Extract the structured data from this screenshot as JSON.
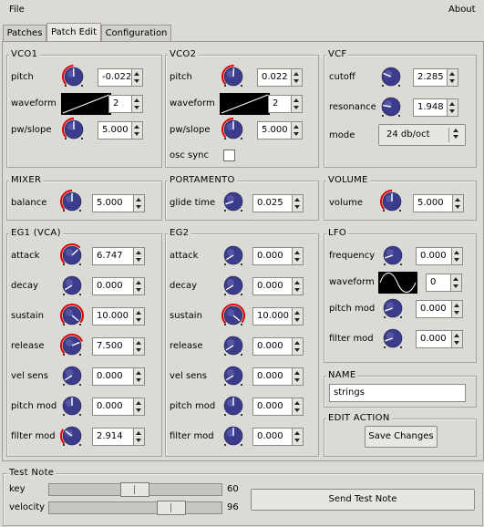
{
  "menubar": {
    "file": "File",
    "about": "About"
  },
  "tabs": [
    "Patches",
    "Patch Edit",
    "Configuration"
  ],
  "vco1": {
    "title": "VCO1",
    "pitch_label": "pitch",
    "pitch_value": "-0.022",
    "waveform_label": "waveform",
    "waveform_value": "2",
    "pw_label": "pw/slope",
    "pw_value": "5.000"
  },
  "vco2": {
    "title": "VCO2",
    "pitch_label": "pitch",
    "pitch_value": "0.022",
    "waveform_label": "waveform",
    "waveform_value": "2",
    "pw_label": "pw/slope",
    "pw_value": "5.000",
    "sync_label": "osc sync"
  },
  "vcf": {
    "title": "VCF",
    "cutoff_label": "cutoff",
    "cutoff_value": "2.285",
    "resonance_label": "resonance",
    "resonance_value": "1.948",
    "mode_label": "mode",
    "mode_value": "24 db/oct"
  },
  "mixer": {
    "title": "MIXER",
    "balance_label": "balance",
    "balance_value": "5.000"
  },
  "portamento": {
    "title": "PORTAMENTO",
    "glide_label": "glide time",
    "glide_value": "0.025"
  },
  "volume": {
    "title": "VOLUME",
    "volume_label": "volume",
    "volume_value": "5.000"
  },
  "eg1": {
    "title": "EG1 (VCA)",
    "rows": [
      {
        "label": "attack",
        "value": "6.747"
      },
      {
        "label": "decay",
        "value": "0.000"
      },
      {
        "label": "sustain",
        "value": "10.000"
      },
      {
        "label": "release",
        "value": "7.500"
      },
      {
        "label": "vel sens",
        "value": "0.000"
      },
      {
        "label": "pitch mod",
        "value": "0.000"
      },
      {
        "label": "filter mod",
        "value": "2.914"
      }
    ]
  },
  "eg2": {
    "title": "EG2",
    "rows": [
      {
        "label": "attack",
        "value": "0.000"
      },
      {
        "label": "decay",
        "value": "0.000"
      },
      {
        "label": "sustain",
        "value": "10.000"
      },
      {
        "label": "release",
        "value": "0.000"
      },
      {
        "label": "vel sens",
        "value": "0.000"
      },
      {
        "label": "pitch mod",
        "value": "0.000"
      },
      {
        "label": "filter mod",
        "value": "0.000"
      }
    ]
  },
  "lfo": {
    "title": "LFO",
    "frequency_label": "frequency",
    "frequency_value": "0.000",
    "waveform_label": "waveform",
    "waveform_value": "0",
    "pitch_label": "pitch mod",
    "pitch_value": "0.000",
    "filter_label": "filter mod",
    "filter_value": "0.000"
  },
  "name": {
    "title": "NAME",
    "value": "strings"
  },
  "edit_action": {
    "title": "EDIT ACTION",
    "button": "Save Changes"
  },
  "test_note": {
    "title": "Test Note",
    "key_label": "key",
    "key_value": "60",
    "velocity_label": "velocity",
    "velocity_value": "96",
    "send_button": "Send Test Note"
  },
  "colors": {
    "knob_body": "#3c3c8c",
    "knob_arc": "#e00000",
    "background": "#dcdad5"
  }
}
